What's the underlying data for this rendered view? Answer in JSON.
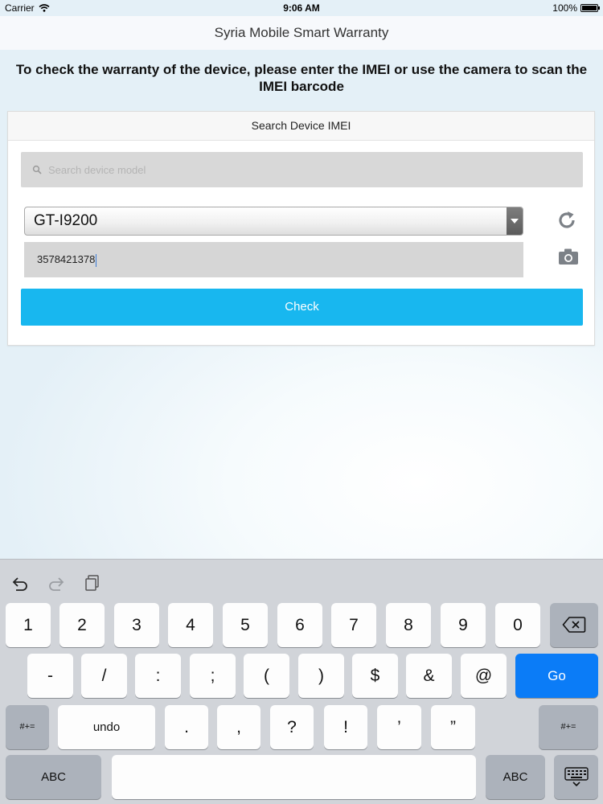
{
  "status_bar": {
    "carrier": "Carrier",
    "time": "9:06 AM",
    "battery": "100%"
  },
  "nav": {
    "title": "Syria Mobile Smart Warranty"
  },
  "intro": {
    "text": "To check the warranty of the device, please enter the IMEI or use the camera to scan the IMEI barcode"
  },
  "card": {
    "header": "Search Device IMEI",
    "search": {
      "placeholder": "Search device model",
      "icon": "search-icon"
    },
    "model_select": {
      "value": "GT-I9200"
    },
    "imei": {
      "value": "3578421378"
    },
    "check_label": "Check",
    "icons": {
      "refresh": "refresh-icon",
      "camera": "camera-icon"
    }
  },
  "keyboard": {
    "toolbar": [
      "undo-icon",
      "redo-icon",
      "paste-icon"
    ],
    "row1": [
      "1",
      "2",
      "3",
      "4",
      "5",
      "6",
      "7",
      "8",
      "9",
      "0"
    ],
    "row2": [
      "-",
      "/",
      ":",
      ";",
      "(",
      ")",
      "$",
      "&",
      "@"
    ],
    "go_label": "Go",
    "row3_left": "#+=",
    "undo_label": "undo",
    "row3": [
      ".",
      ",",
      "?",
      "!",
      "’",
      "”"
    ],
    "row3_right": "#+=",
    "abc_left": "ABC",
    "abc_right": "ABC",
    "colors": {
      "go": "#0b7cf7",
      "check": "#18b7ef"
    }
  }
}
